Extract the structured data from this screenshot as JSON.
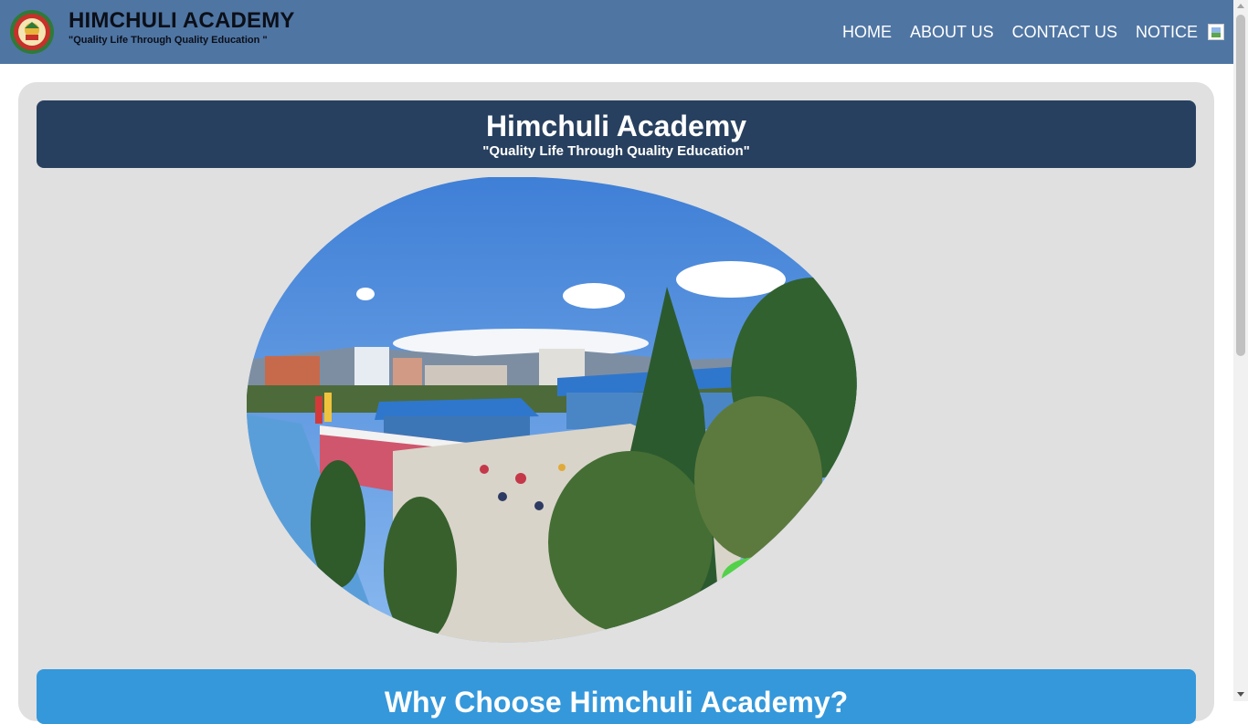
{
  "header": {
    "brand_name": "HIMCHULI ACADEMY",
    "tagline": "\"Quality Life Through Quality Education \"",
    "nav": [
      "HOME",
      "ABOUT US",
      "CONTACT US",
      "NOTICE"
    ]
  },
  "main": {
    "title": "Himchuli Academy",
    "subtitle": "\"Quality Life Through Quality Education\"",
    "why_heading": "Why Choose Himchuli Academy?"
  },
  "colors": {
    "topbar": "#4f75a3",
    "title_box": "#28405f",
    "why_box": "#3498db",
    "panel": "#e0e0e0"
  },
  "icons": [
    "school-logo-icon",
    "broken-image-icon"
  ]
}
